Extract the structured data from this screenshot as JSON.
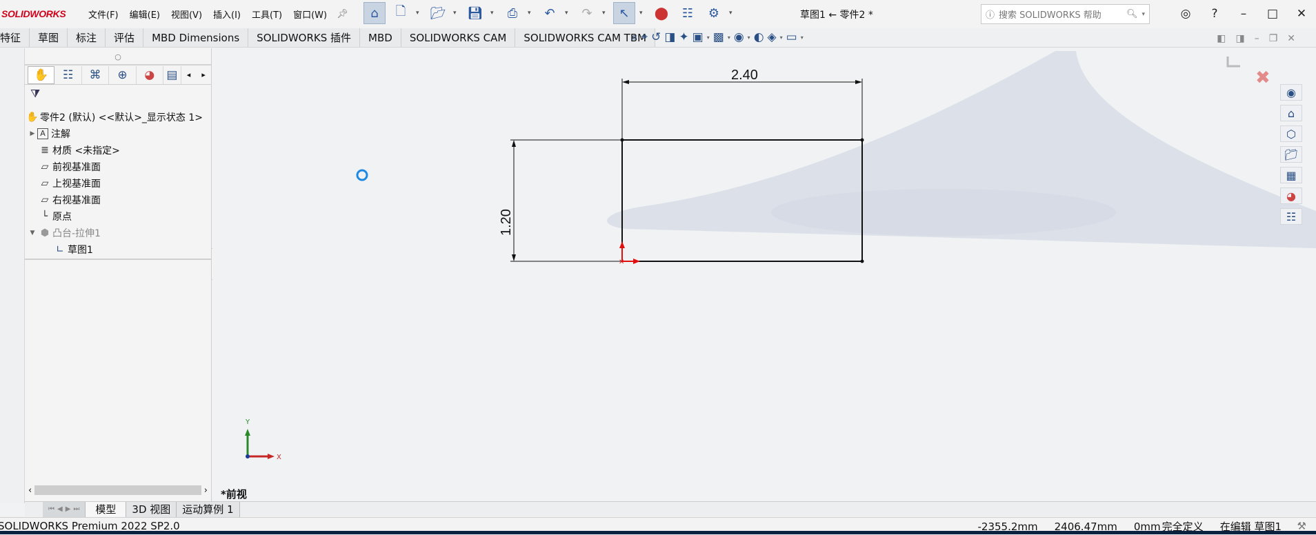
{
  "app": {
    "logo": "SOLIDWORKS",
    "doc_title": "草图1 ← 零件2 *",
    "menu": [
      "文件(F)",
      "编辑(E)",
      "视图(V)",
      "插入(I)",
      "工具(T)",
      "窗口(W)"
    ],
    "search_placeholder": "搜索 SOLIDWORKS 帮助"
  },
  "command_tabs": [
    "特征",
    "草图",
    "标注",
    "评估",
    "MBD Dimensions",
    "SOLIDWORKS 插件",
    "MBD",
    "SOLIDWORKS CAM",
    "SOLIDWORKS CAM TBM"
  ],
  "feature_tree": {
    "root": "零件2 (默认) <<默认>_显示状态 1>",
    "items": [
      {
        "label": "注解",
        "icon": "annotation-icon",
        "expandable": true
      },
      {
        "label": "材质 <未指定>",
        "icon": "material-icon",
        "expandable": false
      },
      {
        "label": "前视基准面",
        "icon": "plane-icon",
        "expandable": false
      },
      {
        "label": "上视基准面",
        "icon": "plane-icon",
        "expandable": false
      },
      {
        "label": "右视基准面",
        "icon": "plane-icon",
        "expandable": false
      },
      {
        "label": "原点",
        "icon": "origin-icon",
        "expandable": false
      },
      {
        "label": "凸台-拉伸1",
        "icon": "extrude-icon",
        "expandable": true
      },
      {
        "label": "草图1",
        "icon": "sketch-icon",
        "expandable": false
      }
    ]
  },
  "sketch": {
    "width_dimension": "2.40",
    "height_dimension": "1.20",
    "view_label": "*前视"
  },
  "triad": {
    "x": "X",
    "y": "Y"
  },
  "bottom_tabs": [
    "模型",
    "3D 视图",
    "运动算例 1"
  ],
  "status": {
    "product": "SOLIDWORKS Premium 2022 SP2.0",
    "x_coord": "-2355.2mm",
    "y_coord": "2406.47mm",
    "z_coord": "0mm",
    "constraint": "完全定义",
    "editing": "在编辑 草图1"
  },
  "colors": {
    "brand": "#d0021b",
    "accent": "#2a4f85"
  }
}
